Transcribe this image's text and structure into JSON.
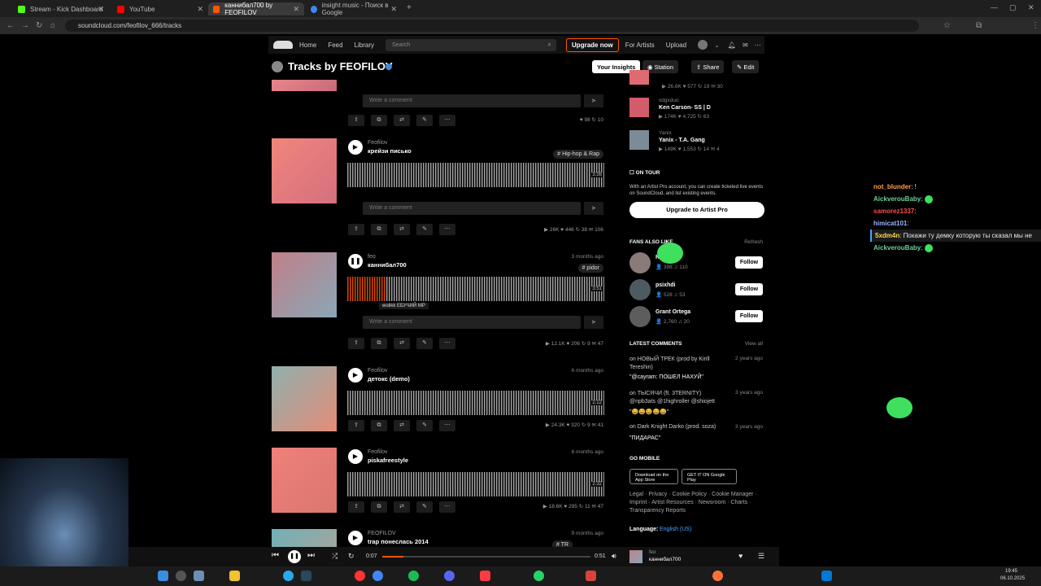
{
  "browser": {
    "tabs": [
      {
        "label": "Stream - Kick Dashboard",
        "color": "#53fc18",
        "active": false
      },
      {
        "label": "YouTube",
        "color": "#ff0000",
        "active": false
      },
      {
        "label": "каннибал700 by FEOFILOV",
        "color": "#ff5500",
        "active": true
      },
      {
        "label": "insight music - Поиск в Google",
        "color": "#4285f4",
        "active": false
      }
    ],
    "url": "soundcloud.com/feofilov_666/tracks"
  },
  "header": {
    "nav": [
      "Home",
      "Feed",
      "Library"
    ],
    "search_placeholder": "Search",
    "upgrade": "Upgrade now",
    "for_artists": "For Artists",
    "upload": "Upload"
  },
  "title_row": {
    "title": "Tracks by FEOFILOV",
    "insights": "Your Insights",
    "station": "Station",
    "share": "Share",
    "edit": "Edit"
  },
  "comment_placeholder": "Write a comment",
  "tracks": [
    {
      "artist": "",
      "name": "",
      "date": "",
      "tag": "",
      "dur": "",
      "stats": "♥ 98  ↻ 10",
      "cover": [
        "#e9858a",
        "#c86b7d"
      ]
    },
    {
      "artist": "Feofilov",
      "name": "крейзи писько",
      "date": "",
      "tag": "# Hip-hop & Rap",
      "dur": "3:36",
      "stats": "▶ 26K  ♥ 446  ↻ 38  ✉ 106",
      "cover": [
        "#f2857c",
        "#d4707e"
      ]
    },
    {
      "artist": "feo",
      "name": "каннибал700",
      "date": "3 months ago",
      "tag": "# pidor",
      "dur": "3:51",
      "stats": "▶ 12.1K  ♥ 206  ↻ 9  ✉ 47",
      "cover": [
        "#c07f8a",
        "#8aa7b6"
      ],
      "progress": 0.15,
      "wave_comment": "wolikk  ЕБУЧИЙ МР"
    },
    {
      "artist": "Feofilov",
      "name": "детокс (demo)",
      "date": "6 months ago",
      "tag": "",
      "dur": "2:12",
      "stats": "▶ 24.3K  ♥ 320  ↻ 9  ✉ 41",
      "cover": [
        "#8fb0ad",
        "#e58c78"
      ]
    },
    {
      "artist": "Feofilov",
      "name": "piskafreestyle",
      "date": "6 months ago",
      "tag": "",
      "dur": "2:32",
      "stats": "▶ 18.6K  ♥ 295  ↻ 11  ✉ 47",
      "cover": [
        "#f07f7a",
        "#d9786e"
      ]
    },
    {
      "artist": "FEOFILOV",
      "name": "trap понеслась 2014",
      "date": "9 months ago",
      "tag": "# TR",
      "dur": "",
      "stats": "",
      "cover": [
        "#6fb0b8",
        "#bfa090"
      ]
    }
  ],
  "sidebar": {
    "related": [
      {
        "artist": "",
        "title": "",
        "stats": "▶ 26.6K  ♥ 577  ↻ 19  ✉ 30",
        "color": "#e06a72"
      },
      {
        "artist": "xdgxduo",
        "title": "Ken Carson- SS | D",
        "stats": "▶ 174K  ♥ 4,725  ↻ 63",
        "color": "#d25c6a"
      },
      {
        "artist": "Yanix",
        "title": "Yanix - T.A. Gang",
        "stats": "▶ 149K  ♥ 1,553  ↻ 14  ✉ 4",
        "color": "#7b8c98"
      }
    ],
    "on_tour": "ON TOUR",
    "on_tour_text": "With an Artist Pro account, you can create ticketed live events on SoundCloud, and list existing events.",
    "upgrade_pro": "Upgrade to Artist Pro",
    "fans_title": "FANS ALSO LIKE",
    "refresh": "Refresh",
    "fans": [
      {
        "name": "R",
        "stats": "👤 398  ♫ 110",
        "follow": "Follow"
      },
      {
        "name": "psixhdi",
        "stats": "👤 528  ♫ 53",
        "follow": "Follow"
      },
      {
        "name": "Grant Ortega",
        "stats": "👤 2,760  ♫ 20",
        "follow": "Follow"
      }
    ],
    "comments_title": "LATEST COMMENTS",
    "view_all": "View all",
    "comments": [
      {
        "on": "on НОВЫЙ ТРЕК (prod by Kirill Tereshin)",
        "ago": "2 years ago",
        "text": "\"@cayram: ПОШЕЛ НАХУЙ\""
      },
      {
        "on": "on ТЫСЯЧИ (ft. 3TERNITY) @npb3ats @1highroller @shiojett",
        "ago": "3 years ago",
        "text": "\"😀😀😀😀😀\""
      },
      {
        "on": "on Dark Knight Darko (prod. soza)",
        "ago": "3 years ago",
        "text": "\"ПИДАРАС\""
      }
    ],
    "go_mobile": "GO MOBILE",
    "app_store": "Download on the App Store",
    "google_play": "GET IT ON Google Play",
    "legal_lines": [
      "Legal · Privacy · Cookie Policy · Cookie Manager ·",
      "Imprint · Artist Resources · Newsroom · Charts ·",
      "Transparency Reports"
    ],
    "language_label": "Language:",
    "language_value": "English (US)"
  },
  "chat": [
    {
      "user": "not_blunder",
      "color": "#ff9f43",
      "text": ": !"
    },
    {
      "user": "AickverouBaby",
      "color": "#6fcf97",
      "text": ":"
    },
    {
      "user": "samorez1337",
      "color": "#ff4d4d",
      "text": ":"
    },
    {
      "user": "himicat101",
      "color": "#9ab4ff",
      "text": ":"
    },
    {
      "user": "5xdm4n",
      "color": "#ffd84d",
      "text": ": Покажи ту демку которую ты сказал мы не достойны @realfeo",
      "highlight": true
    },
    {
      "user": "AickverouBaby",
      "color": "#6fcf97",
      "text": ":"
    }
  ],
  "player": {
    "current": "0:07",
    "total": "0:51",
    "progress": 0.1,
    "artist": "feo",
    "title": "каннибал700"
  },
  "clock": {
    "time": "19:45",
    "date": "06.10.2025"
  }
}
